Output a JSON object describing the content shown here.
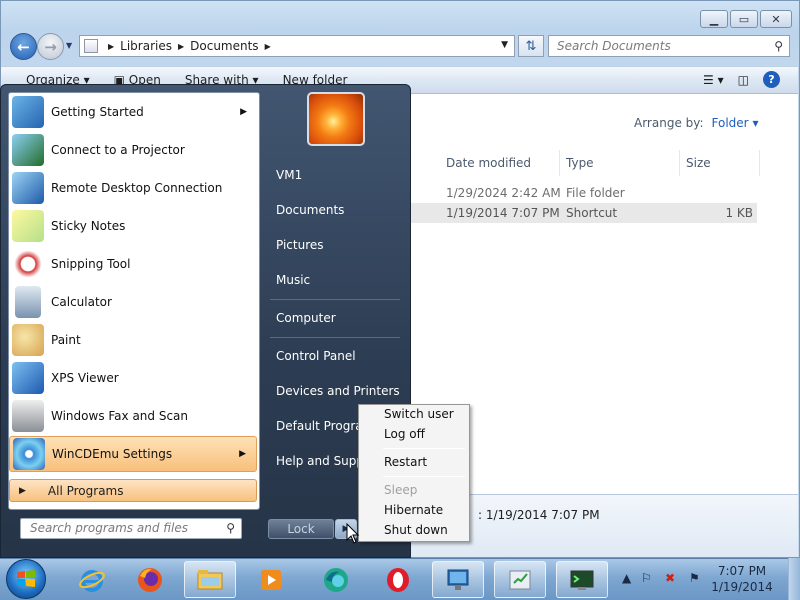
{
  "explorer": {
    "breadcrumb": [
      "Libraries",
      "Documents"
    ],
    "search_placeholder": "Search Documents",
    "toolbar": {
      "organize": "Organize",
      "open": "Open",
      "share_with": "Share with",
      "new_folder": "New folder"
    },
    "arrange_label": "Arrange by:",
    "arrange_value": "Folder",
    "columns": [
      "Date modified",
      "Type",
      "Size"
    ],
    "rows": [
      {
        "date": "1/29/2024 2:42 AM",
        "type": "File folder",
        "size": ""
      },
      {
        "date": "1/19/2014 7:07 PM",
        "type": "Shortcut",
        "size": "1 KB"
      }
    ],
    "details_date": ": 1/19/2014 7:07 PM"
  },
  "start_menu": {
    "programs": [
      {
        "label": "Getting Started",
        "icon": "getting-started-icon",
        "submenu": true
      },
      {
        "label": "Connect to a Projector",
        "icon": "projector-icon",
        "submenu": false
      },
      {
        "label": "Remote Desktop Connection",
        "icon": "remote-desktop-icon",
        "submenu": false
      },
      {
        "label": "Sticky Notes",
        "icon": "sticky-notes-icon",
        "submenu": false
      },
      {
        "label": "Snipping Tool",
        "icon": "snipping-tool-icon",
        "submenu": false
      },
      {
        "label": "Calculator",
        "icon": "calculator-icon",
        "submenu": false
      },
      {
        "label": "Paint",
        "icon": "paint-icon",
        "submenu": false
      },
      {
        "label": "XPS Viewer",
        "icon": "xps-viewer-icon",
        "submenu": false
      },
      {
        "label": "Windows Fax and Scan",
        "icon": "fax-scan-icon",
        "submenu": false
      },
      {
        "label": "WinCDEmu Settings",
        "icon": "wincdemu-icon",
        "submenu": true
      }
    ],
    "all_programs": "All Programs",
    "search_placeholder": "Search programs and files",
    "right_links": [
      "VM1",
      "Documents",
      "Pictures",
      "Music",
      "Computer",
      "Control Panel",
      "Devices and Printers",
      "Default Programs",
      "Help and Support"
    ],
    "lock_label": "Lock"
  },
  "shutdown_menu": {
    "items": [
      {
        "label": "Switch user",
        "enabled": true
      },
      {
        "label": "Log off",
        "enabled": true
      },
      {
        "label": "Restart",
        "enabled": true
      },
      {
        "label": "Sleep",
        "enabled": false
      },
      {
        "label": "Hibernate",
        "enabled": true
      },
      {
        "label": "Shut down",
        "enabled": true
      }
    ]
  },
  "taskbar": {
    "apps": [
      "internet-explorer-icon",
      "firefox-icon",
      "file-explorer-icon",
      "media-player-icon",
      "edge-icon",
      "opera-icon",
      "control-panel-icon",
      "task-icon",
      "terminal-icon"
    ],
    "time": "7:07 PM",
    "date": "1/19/2014"
  }
}
